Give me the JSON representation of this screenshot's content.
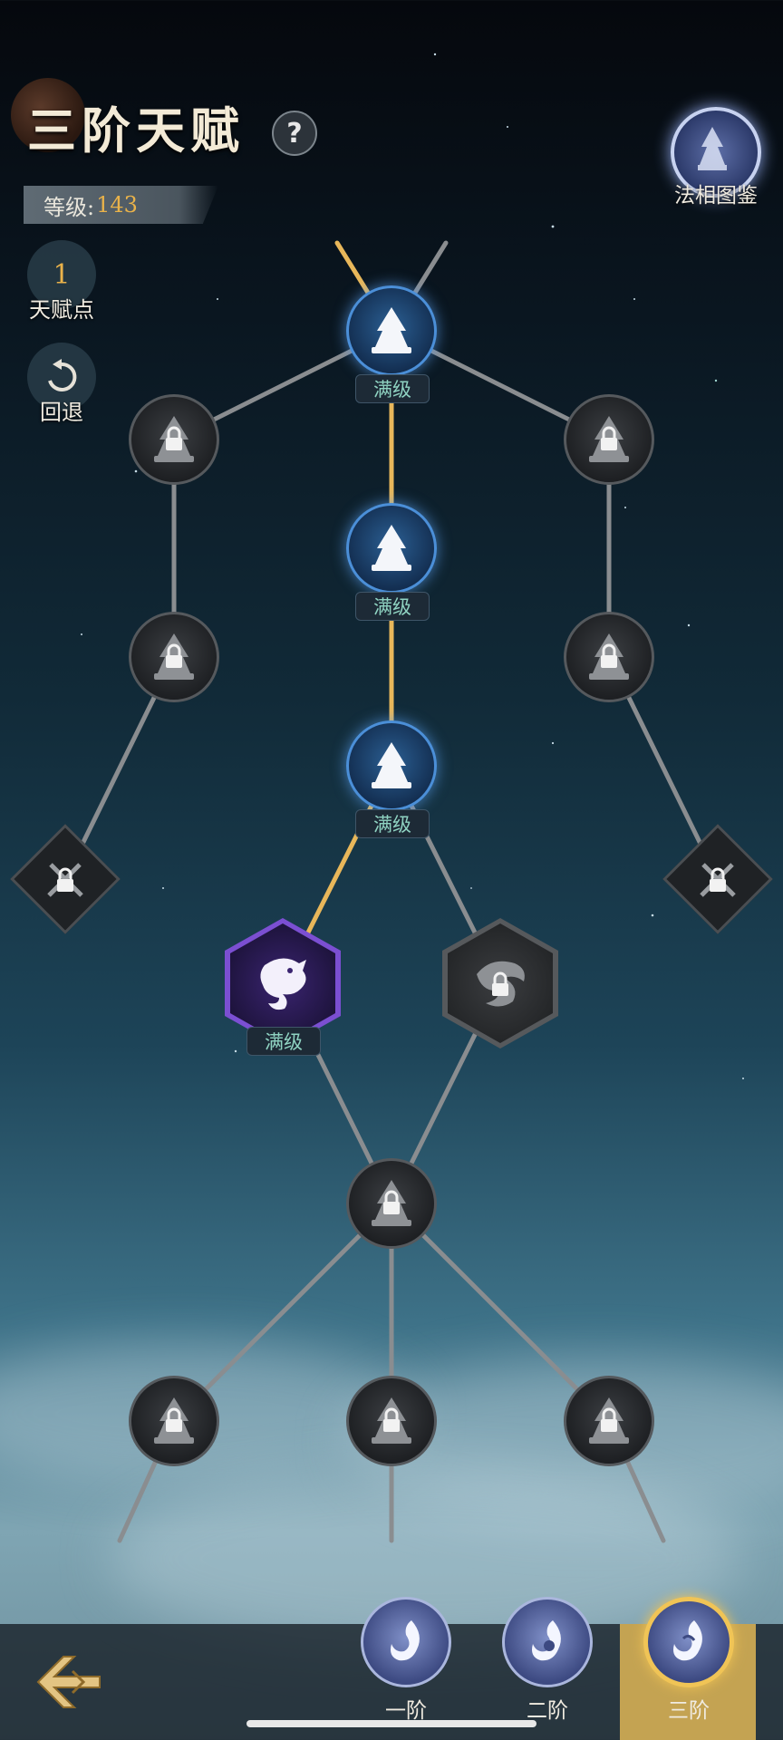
{
  "header": {
    "title": "三阶天赋",
    "help_icon": "question-icon",
    "help_label": "?",
    "level_label": "等级:",
    "level_value": "143"
  },
  "side_panel": {
    "talent_points_value": "1",
    "talent_points_label": "天赋点",
    "undo_icon": "undo-icon",
    "undo_label": "回退"
  },
  "codex": {
    "icon": "dharma-figure-icon",
    "label": "法相图鉴"
  },
  "tree": {
    "max_label": "满级",
    "nodes": [
      {
        "id": "n1",
        "state": "max",
        "icon": "buddha-statue-icon"
      },
      {
        "id": "n2",
        "state": "max",
        "icon": "buddha-statue-icon"
      },
      {
        "id": "n3",
        "state": "max",
        "icon": "buddha-statue-icon"
      },
      {
        "id": "l1",
        "state": "locked",
        "icon": "statue-lock-icon"
      },
      {
        "id": "l2",
        "state": "locked",
        "icon": "statue-lock-icon"
      },
      {
        "id": "r1",
        "state": "locked",
        "icon": "statue-lock-icon"
      },
      {
        "id": "r2",
        "state": "locked",
        "icon": "statue-lock-icon"
      },
      {
        "id": "ld",
        "state": "locked",
        "icon": "sword-lock-icon"
      },
      {
        "id": "rd",
        "state": "locked",
        "icon": "sword-lock-icon"
      },
      {
        "id": "dragon",
        "state": "max",
        "icon": "dragon-icon"
      },
      {
        "id": "phoenix",
        "state": "locked",
        "icon": "phoenix-lock-icon"
      },
      {
        "id": "c",
        "state": "locked",
        "icon": "statue-lock-icon"
      },
      {
        "id": "b1",
        "state": "locked",
        "icon": "statue-lock-icon"
      },
      {
        "id": "b2",
        "state": "locked",
        "icon": "statue-lock-icon"
      },
      {
        "id": "b3",
        "state": "locked",
        "icon": "statue-lock-icon"
      }
    ]
  },
  "bottom_bar": {
    "back_icon": "back-arrow-icon",
    "tiers": [
      {
        "label": "一阶",
        "icon": "flame-swirl-icon",
        "selected": false
      },
      {
        "label": "二阶",
        "icon": "flame-swirl-icon",
        "selected": false
      },
      {
        "label": "三阶",
        "icon": "flame-swirl-icon",
        "selected": true
      }
    ]
  },
  "colors": {
    "accent_gold": "#e9b24a",
    "max_text": "#8fd3c2",
    "active_link": "#e8b75a",
    "locked_link": "#8a8d90",
    "active_node": "#4b8fd8",
    "dragon_frame": "#7b4fd2"
  }
}
